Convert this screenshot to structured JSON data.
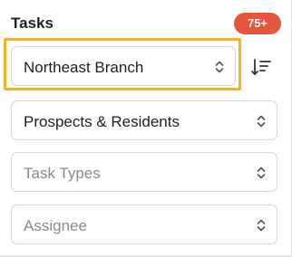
{
  "panel": {
    "title": "Tasks",
    "badge": "75+",
    "colors": {
      "badge": "#e4573d",
      "highlight": "#f5b321"
    }
  },
  "filters": {
    "branch": {
      "value": "Northeast Branch"
    },
    "contacts": {
      "value": "Prospects & Residents"
    },
    "task_types": {
      "placeholder": "Task Types"
    },
    "assignee": {
      "placeholder": "Assignee"
    }
  },
  "icons": {
    "sort": "sort-icon",
    "chevron": "chevron-up-down-icon"
  }
}
